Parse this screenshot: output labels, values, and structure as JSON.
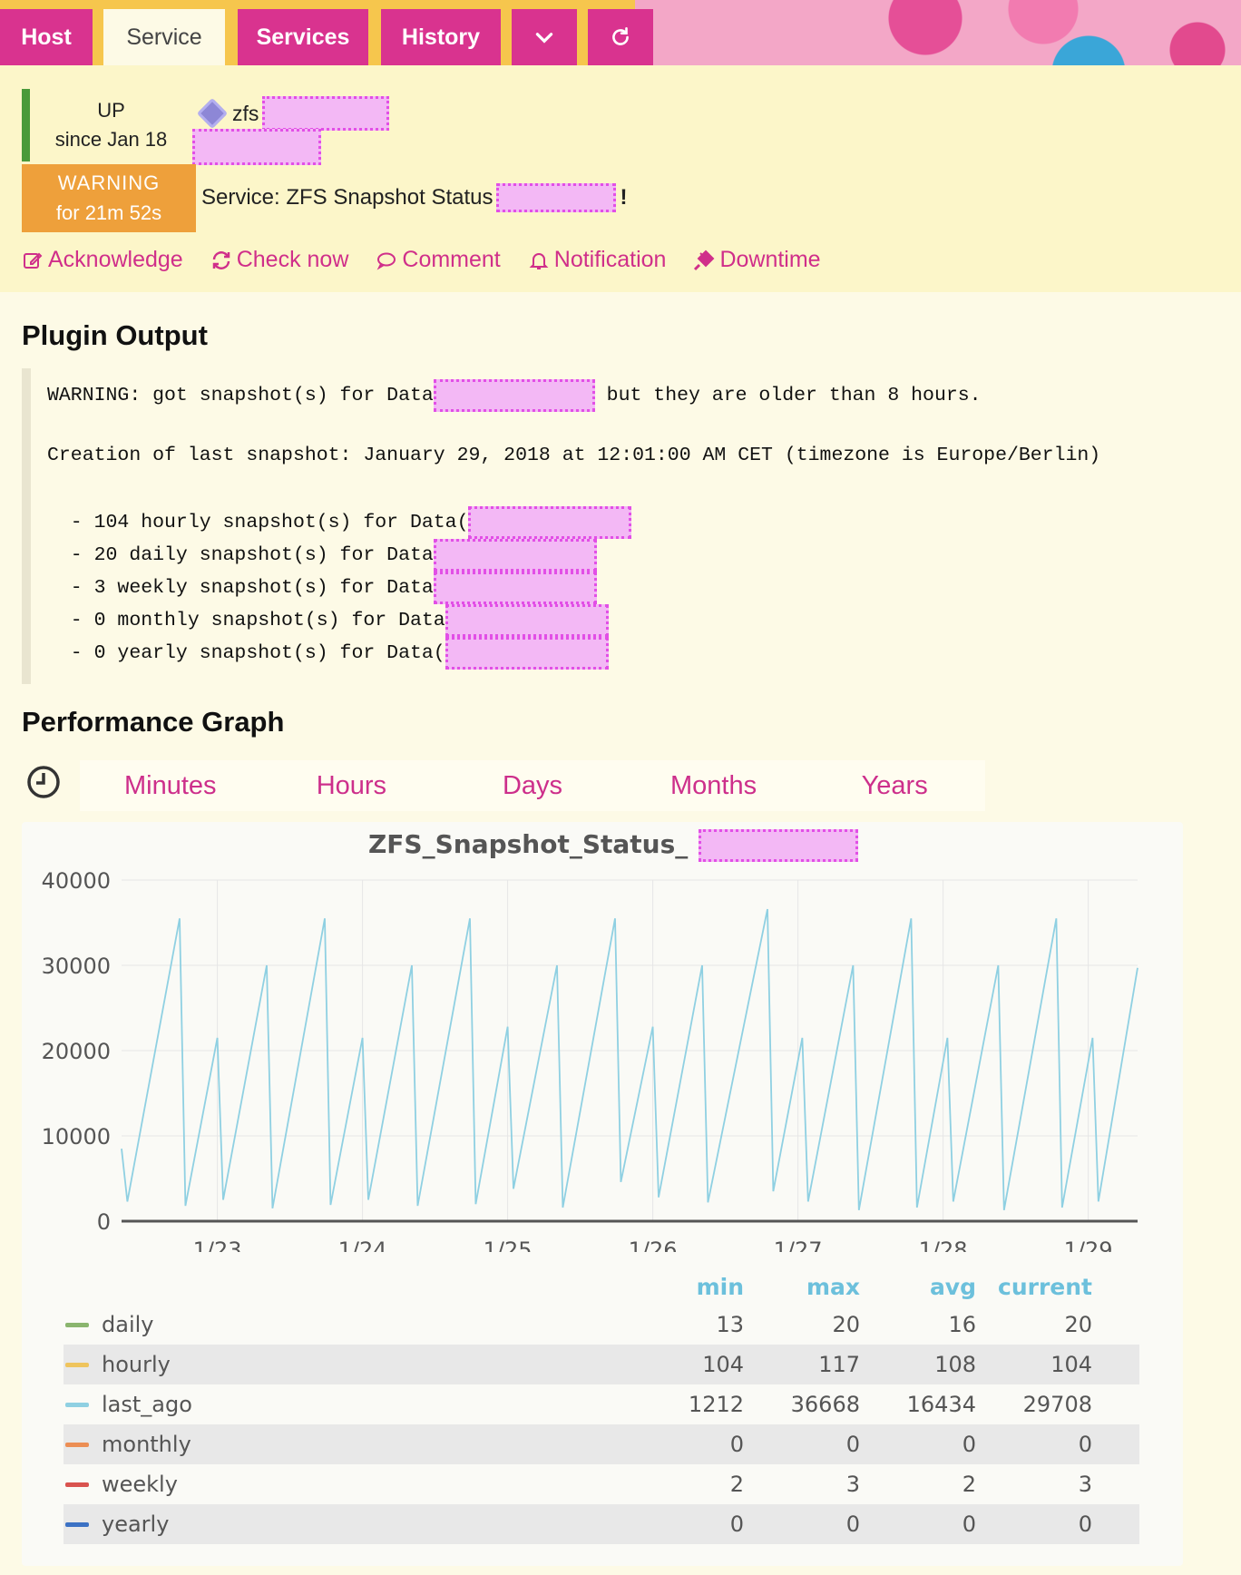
{
  "tabs": {
    "host": "Host",
    "service": "Service",
    "services": "Services",
    "history": "History"
  },
  "status": {
    "up_state": "UP",
    "up_since": "since Jan 18",
    "warn_state": "WARNING",
    "warn_for": "for 21m 52s"
  },
  "host": {
    "name": "zfs"
  },
  "service": {
    "label": "Service: ZFS Snapshot Status",
    "suffix": "!"
  },
  "actions": {
    "acknowledge": "Acknowledge",
    "check_now": "Check now",
    "comment": "Comment",
    "notification": "Notification",
    "downtime": "Downtime"
  },
  "plugin_output": {
    "heading": "Plugin Output",
    "line1_a": "WARNING: got snapshot(s) for Data",
    "line1_b": " but they are older than 8 hours.",
    "line2": "Creation of last snapshot: January 29, 2018 at 12:01:00 AM CET (timezone is Europe/Berlin)",
    "items": [
      "  - 104 hourly snapshot(s) for Data(",
      "  - 20 daily snapshot(s) for Data",
      "  - 3 weekly snapshot(s) for Data",
      "  - 0 monthly snapshot(s) for Data",
      "  - 0 yearly snapshot(s) for Data("
    ]
  },
  "performance": {
    "heading": "Performance Graph",
    "ranges": [
      "Minutes",
      "Hours",
      "Days",
      "Months",
      "Years"
    ]
  },
  "chart_data": {
    "type": "line",
    "title": "ZFS_Snapshot_Status_",
    "ylim": [
      0,
      40000
    ],
    "yticks": [
      "0",
      "10000",
      "20000",
      "30000",
      "40000"
    ],
    "xticks": [
      "1/23",
      "1/24",
      "1/25",
      "1/26",
      "1/27",
      "1/28",
      "1/29"
    ],
    "x_range": [
      0,
      7
    ],
    "grid": true,
    "series": [
      {
        "name": "last_ago",
        "color": "#8fd0e2",
        "points": [
          [
            0.0,
            8500
          ],
          [
            0.04,
            2300
          ],
          [
            0.4,
            35500
          ],
          [
            0.44,
            1800
          ],
          [
            0.66,
            21500
          ],
          [
            0.7,
            2500
          ],
          [
            1.0,
            30000
          ],
          [
            1.04,
            1500
          ],
          [
            1.4,
            35500
          ],
          [
            1.44,
            1900
          ],
          [
            1.66,
            21500
          ],
          [
            1.7,
            2500
          ],
          [
            2.0,
            30000
          ],
          [
            2.04,
            1800
          ],
          [
            2.4,
            35500
          ],
          [
            2.44,
            2000
          ],
          [
            2.66,
            22800
          ],
          [
            2.7,
            3800
          ],
          [
            3.0,
            30000
          ],
          [
            3.04,
            1600
          ],
          [
            3.4,
            35500
          ],
          [
            3.44,
            4600
          ],
          [
            3.66,
            22800
          ],
          [
            3.7,
            2800
          ],
          [
            4.0,
            30000
          ],
          [
            4.04,
            2200
          ],
          [
            4.45,
            36600
          ],
          [
            4.49,
            3500
          ],
          [
            4.69,
            21500
          ],
          [
            4.73,
            2300
          ],
          [
            5.04,
            30000
          ],
          [
            5.08,
            1300
          ],
          [
            5.44,
            35500
          ],
          [
            5.48,
            1600
          ],
          [
            5.69,
            21500
          ],
          [
            5.73,
            2300
          ],
          [
            6.04,
            30000
          ],
          [
            6.08,
            1300
          ],
          [
            6.44,
            35500
          ],
          [
            6.48,
            1600
          ],
          [
            6.69,
            21500
          ],
          [
            6.73,
            2300
          ],
          [
            7.0,
            29700
          ]
        ]
      }
    ],
    "legend": {
      "headers": [
        "min",
        "max",
        "avg",
        "current"
      ],
      "rows": [
        {
          "name": "daily",
          "color": "#8ab56e",
          "min": "13",
          "max": "20",
          "avg": "16",
          "current": "20"
        },
        {
          "name": "hourly",
          "color": "#efc45d",
          "min": "104",
          "max": "117",
          "avg": "108",
          "current": "104"
        },
        {
          "name": "last_ago",
          "color": "#8fd0e2",
          "min": "1212",
          "max": "36668",
          "avg": "16434",
          "current": "29708"
        },
        {
          "name": "monthly",
          "color": "#ec8e54",
          "min": "0",
          "max": "0",
          "avg": "0",
          "current": "0"
        },
        {
          "name": "weekly",
          "color": "#d9534f",
          "min": "2",
          "max": "3",
          "avg": "2",
          "current": "3"
        },
        {
          "name": "yearly",
          "color": "#3c72c4",
          "min": "0",
          "max": "0",
          "avg": "0",
          "current": "0"
        }
      ]
    }
  }
}
